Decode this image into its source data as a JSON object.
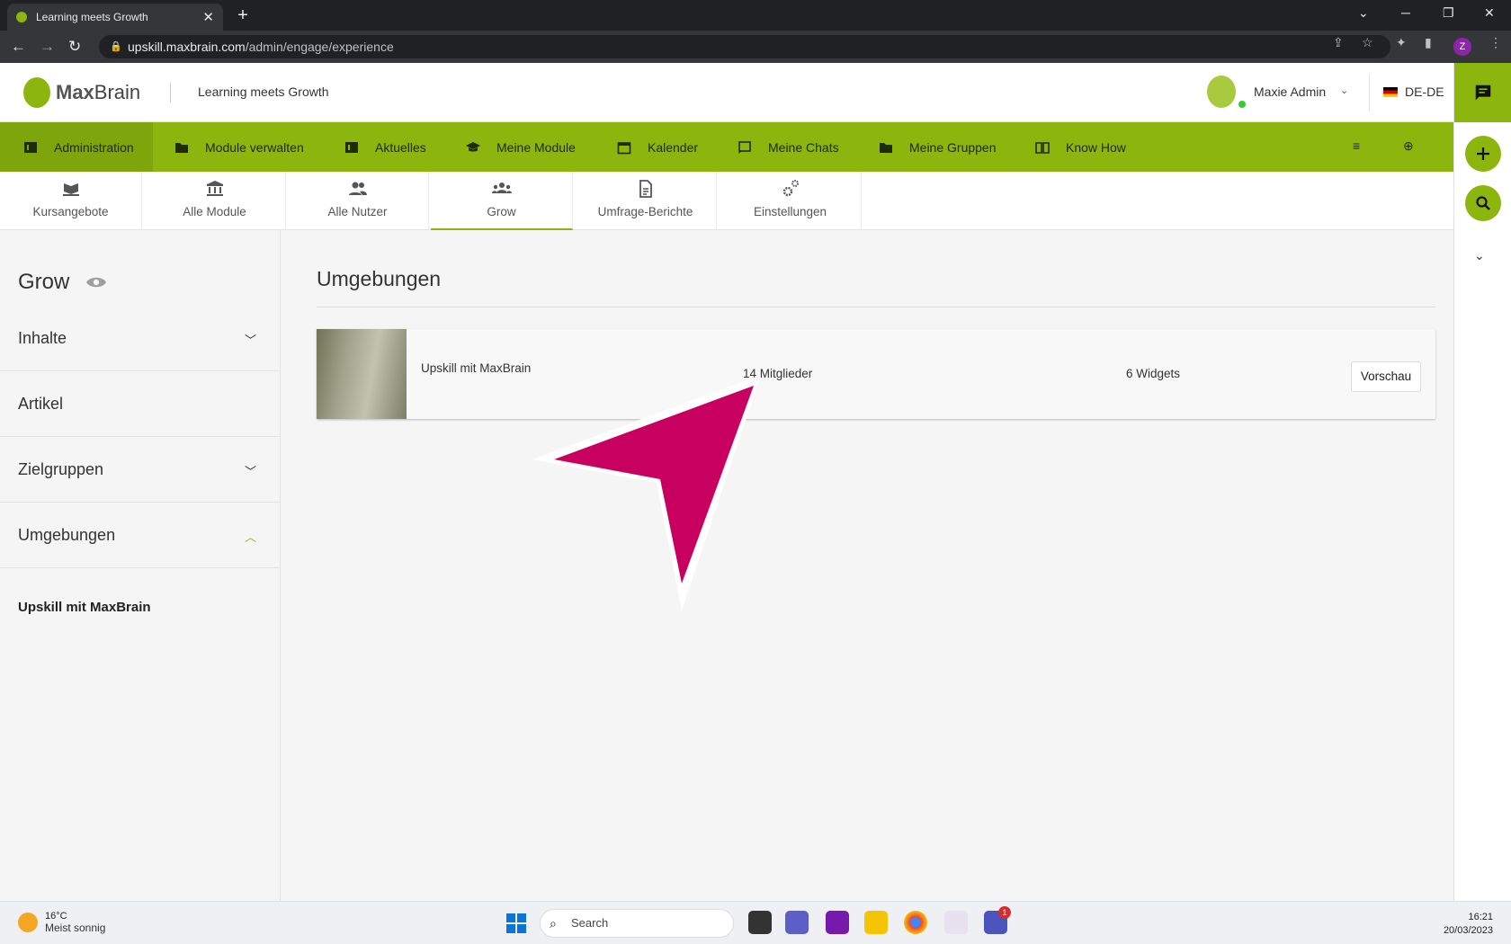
{
  "browser": {
    "tab_title": "Learning meets Growth",
    "url_domain": "upskill.maxbrain.com",
    "url_path": "/admin/engage/experience",
    "profile_initial": "Z"
  },
  "header": {
    "logo_text_bold": "Max",
    "logo_text": "Brain",
    "tagline": "Learning meets Growth",
    "user_name": "Maxie Admin",
    "language": "DE-DE"
  },
  "main_nav": [
    {
      "label": "Administration",
      "icon": "admin-icon",
      "active": true
    },
    {
      "label": "Module verwalten",
      "icon": "folder-icon"
    },
    {
      "label": "Aktuelles",
      "icon": "news-icon"
    },
    {
      "label": "Meine Module",
      "icon": "graduation-cap-icon"
    },
    {
      "label": "Kalender",
      "icon": "calendar-icon"
    },
    {
      "label": "Meine Chats",
      "icon": "chat-icon"
    },
    {
      "label": "Meine Gruppen",
      "icon": "group-folder-icon"
    },
    {
      "label": "Know How",
      "icon": "book-icon"
    }
  ],
  "sub_nav": [
    {
      "label": "Kursangebote",
      "icon": "course-offer-icon"
    },
    {
      "label": "Alle Module",
      "icon": "institution-icon"
    },
    {
      "label": "Alle Nutzer",
      "icon": "users-icon"
    },
    {
      "label": "Grow",
      "icon": "groups-icon",
      "active": true
    },
    {
      "label": "Umfrage-Berichte",
      "icon": "report-icon"
    },
    {
      "label": "Einstellungen",
      "icon": "settings-icon"
    }
  ],
  "sidebar": {
    "title": "Grow",
    "sections": [
      {
        "label": "Inhalte",
        "expanded": false
      },
      {
        "label": "Artikel"
      },
      {
        "label": "Zielgruppen",
        "expanded": false
      },
      {
        "label": "Umgebungen",
        "expanded": true
      }
    ],
    "sub_item": "Upskill mit MaxBrain"
  },
  "content": {
    "title": "Umgebungen",
    "environment": {
      "name": "Upskill mit MaxBrain",
      "members": "14 Mitglieder",
      "widgets": "6 Widgets",
      "preview_button": "Vorschau"
    }
  },
  "taskbar": {
    "temperature": "16°C",
    "weather": "Meist sonnig",
    "search_placeholder": "Search",
    "time": "16:21",
    "date": "20/03/2023",
    "teams_badge": "1"
  },
  "colors": {
    "accent": "#8cb60e",
    "pointer": "#c8005f"
  }
}
